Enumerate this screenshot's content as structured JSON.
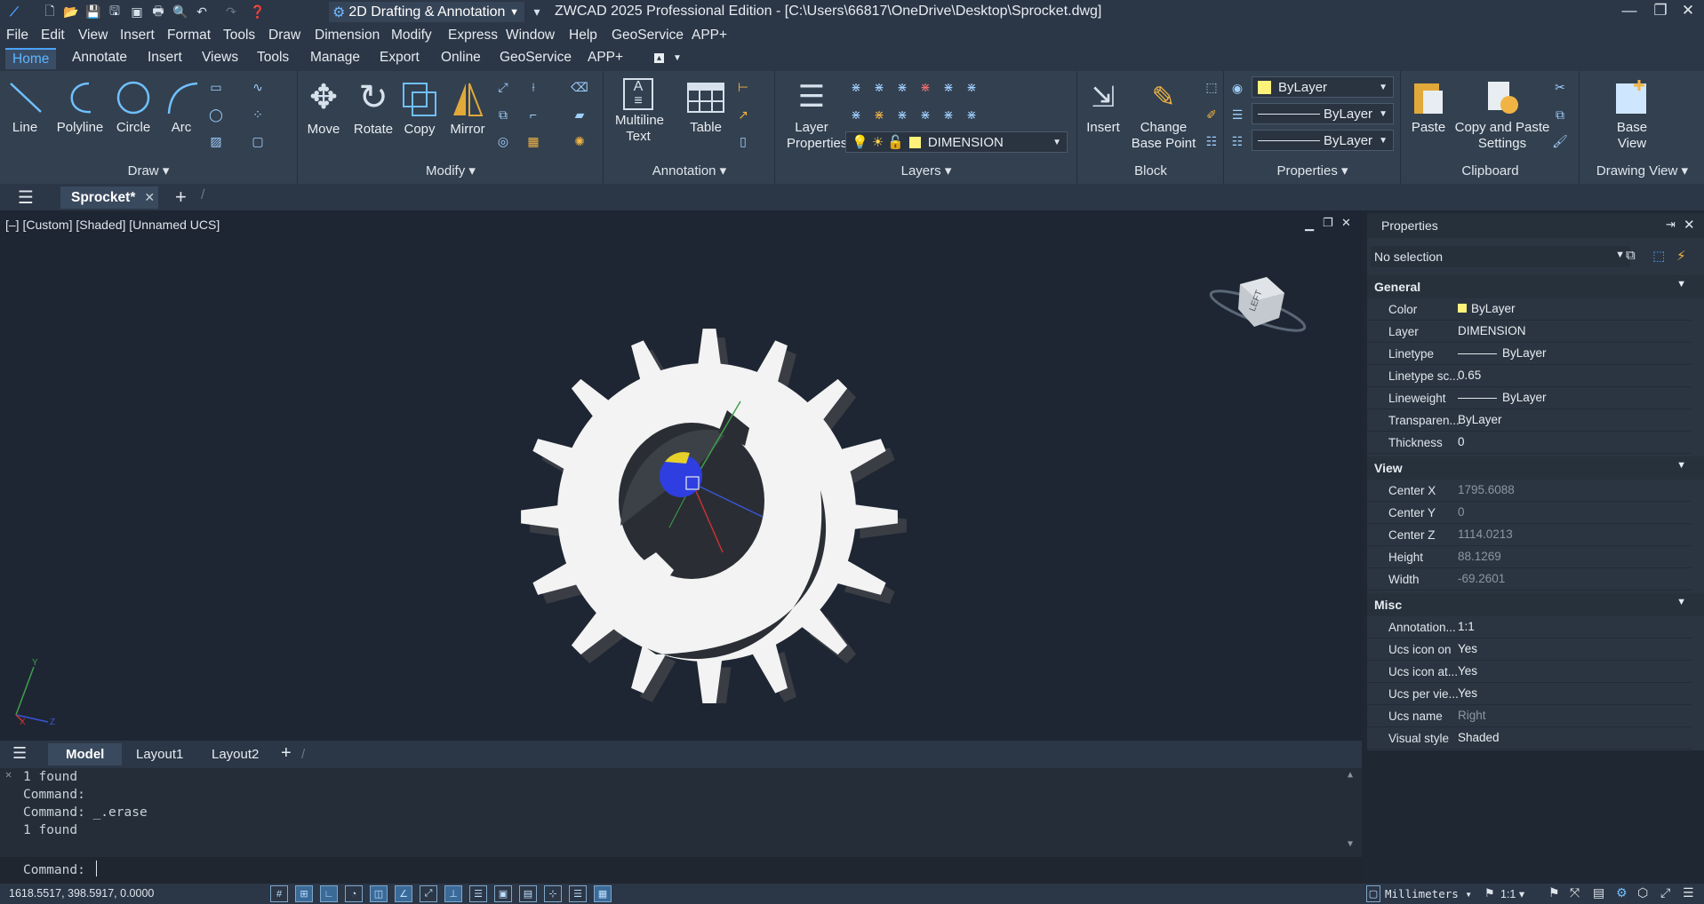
{
  "title": {
    "workspace": "2D Drafting & Annotation",
    "window_title": "ZWCAD 2025 Professional Edition - [C:\\Users\\66817\\OneDrive\\Desktop\\Sprocket.dwg]"
  },
  "menu": [
    "File",
    "Edit",
    "View",
    "Insert",
    "Format",
    "Tools",
    "Draw",
    "Dimension",
    "Modify",
    "Express",
    "Window",
    "Help",
    "GeoService",
    "APP+"
  ],
  "ribbon_tabs": [
    "Home",
    "Annotate",
    "Insert",
    "Views",
    "Tools",
    "Manage",
    "Export",
    "Online",
    "GeoService",
    "APP+"
  ],
  "ribbon": {
    "draw": {
      "title": "Draw",
      "line": "Line",
      "polyline": "Polyline",
      "circle": "Circle",
      "arc": "Arc"
    },
    "modify": {
      "title": "Modify",
      "move": "Move",
      "rotate": "Rotate",
      "copy": "Copy",
      "mirror": "Mirror"
    },
    "annotation": {
      "title": "Annotation",
      "mtext_1": "Multiline",
      "mtext_2": "Text",
      "table": "Table"
    },
    "layers": {
      "title": "Layers",
      "props_1": "Layer",
      "props_2": "Properties",
      "current": "DIMENSION"
    },
    "block": {
      "title": "Block",
      "insert": "Insert",
      "cbp_1": "Change",
      "cbp_2": "Base Point"
    },
    "properties": {
      "title": "Properties",
      "color": "ByLayer",
      "linetype": "ByLayer",
      "lineweight": "ByLayer"
    },
    "clipboard": {
      "title": "Clipboard",
      "paste": "Paste",
      "cps_1": "Copy and Paste",
      "cps_2": "Settings"
    },
    "drawing_view": {
      "title": "Drawing View",
      "base_1": "Base",
      "base_2": "View"
    }
  },
  "doc_tab": "Sprocket*",
  "viewport_label": "[–] [Custom] [Shaded] [Unnamed UCS]",
  "viewcube_face": "LEFT",
  "ucs_labels": {
    "y": "Y",
    "x": "X",
    "z": "Z"
  },
  "properties_panel": {
    "title": "Properties",
    "selection": "No selection",
    "general": {
      "title": "General",
      "rows": [
        {
          "k": "Color",
          "v": "ByLayer"
        },
        {
          "k": "Layer",
          "v": "DIMENSION"
        },
        {
          "k": "Linetype",
          "v": "ByLayer"
        },
        {
          "k": "Linetype sc...",
          "v": "0.65"
        },
        {
          "k": "Lineweight",
          "v": "ByLayer"
        },
        {
          "k": "Transparen...",
          "v": "ByLayer"
        },
        {
          "k": "Thickness",
          "v": "0"
        }
      ]
    },
    "view": {
      "title": "View",
      "rows": [
        {
          "k": "Center X",
          "v": "1795.6088"
        },
        {
          "k": "Center Y",
          "v": "0"
        },
        {
          "k": "Center Z",
          "v": "1114.0213"
        },
        {
          "k": "Height",
          "v": "88.1269"
        },
        {
          "k": "Width",
          "v": "-69.2601"
        }
      ]
    },
    "misc": {
      "title": "Misc",
      "rows": [
        {
          "k": "Annotation...",
          "v": "1:1"
        },
        {
          "k": "Ucs icon on",
          "v": "Yes"
        },
        {
          "k": "Ucs icon at...",
          "v": "Yes"
        },
        {
          "k": "Ucs per vie...",
          "v": "Yes"
        },
        {
          "k": "Ucs name",
          "v": "Right"
        },
        {
          "k": "Visual style",
          "v": "Shaded"
        }
      ]
    }
  },
  "layout_tabs": [
    "Model",
    "Layout1",
    "Layout2"
  ],
  "command_history": [
    "1 found",
    "Command:",
    "Command: _.erase",
    "1 found"
  ],
  "command_prompt": "Command:",
  "status": {
    "coords": "1618.5517, 398.5917, 0.0000",
    "units": "Millimeters",
    "scale": "1:1"
  },
  "colors": {
    "accent": "#4aa3ff",
    "bylayer_swatch": "#fff27a",
    "titlebar": "#2b3646",
    "ribbon": "#33404f",
    "viewport": "#1e2633"
  }
}
